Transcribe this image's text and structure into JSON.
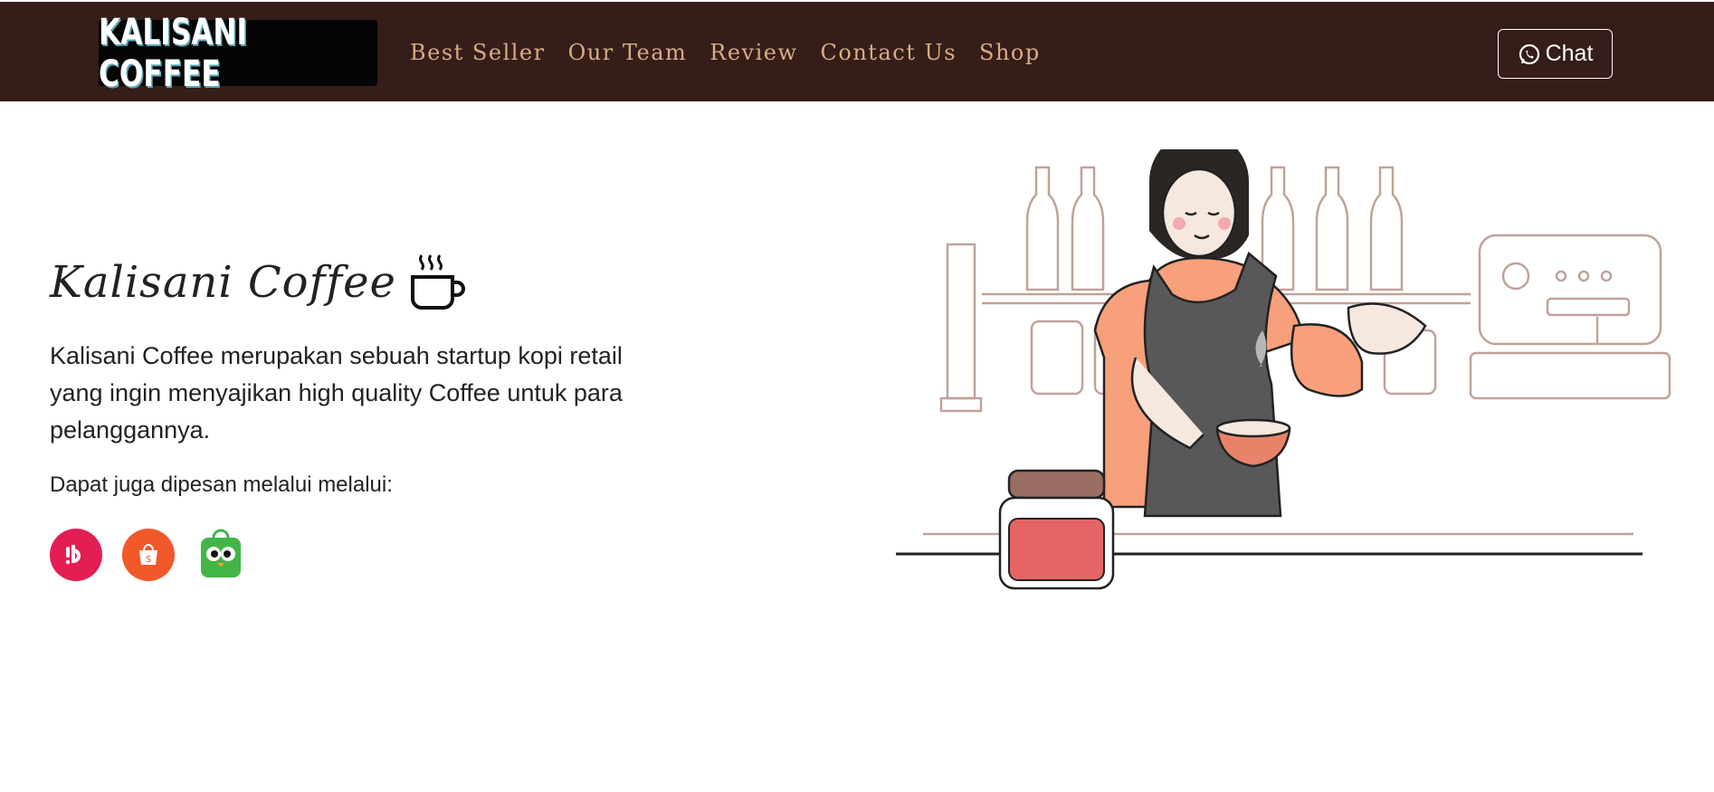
{
  "header": {
    "logo_text": "KALISANI COFFEE",
    "nav": [
      "Best Seller",
      "Our Team",
      "Review",
      "Contact Us",
      "Shop"
    ],
    "chat_label": "Chat"
  },
  "hero": {
    "title": "Kalisani Coffee",
    "description": "Kalisani Coffee merupakan sebuah startup kopi retail yang ingin menyajikan high quality Coffee untuk para pelanggannya.",
    "order_label": "Dapat juga dipesan melalui melalui:",
    "marketplaces": [
      "bukalapak-icon",
      "shopee-icon",
      "tokopedia-icon"
    ]
  },
  "colors": {
    "header_bg": "#351d19",
    "nav_text": "#d6ad86",
    "bukalapak": "#e31e52",
    "shopee": "#f1582a",
    "tokopedia": "#42b549"
  }
}
